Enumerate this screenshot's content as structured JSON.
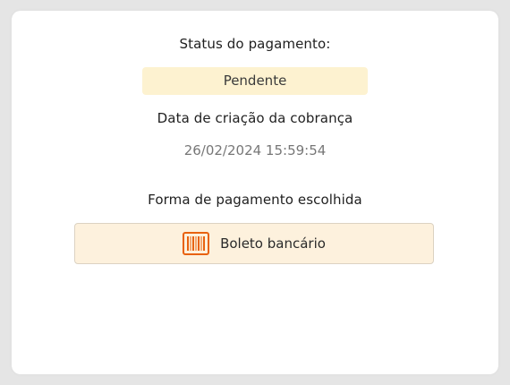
{
  "payment": {
    "status_label": "Status do pagamento:",
    "status_value": "Pendente",
    "created_label": "Data de criação da cobrança",
    "created_value": "26/02/2024 15:59:54",
    "method_label": "Forma de pagamento escolhida",
    "method_value": "Boleto bancário",
    "method_icon": "barcode-icon"
  },
  "colors": {
    "status_badge_bg": "#fdf2d0",
    "method_box_bg": "#fdf1dd",
    "icon_accent": "#e8620f"
  }
}
